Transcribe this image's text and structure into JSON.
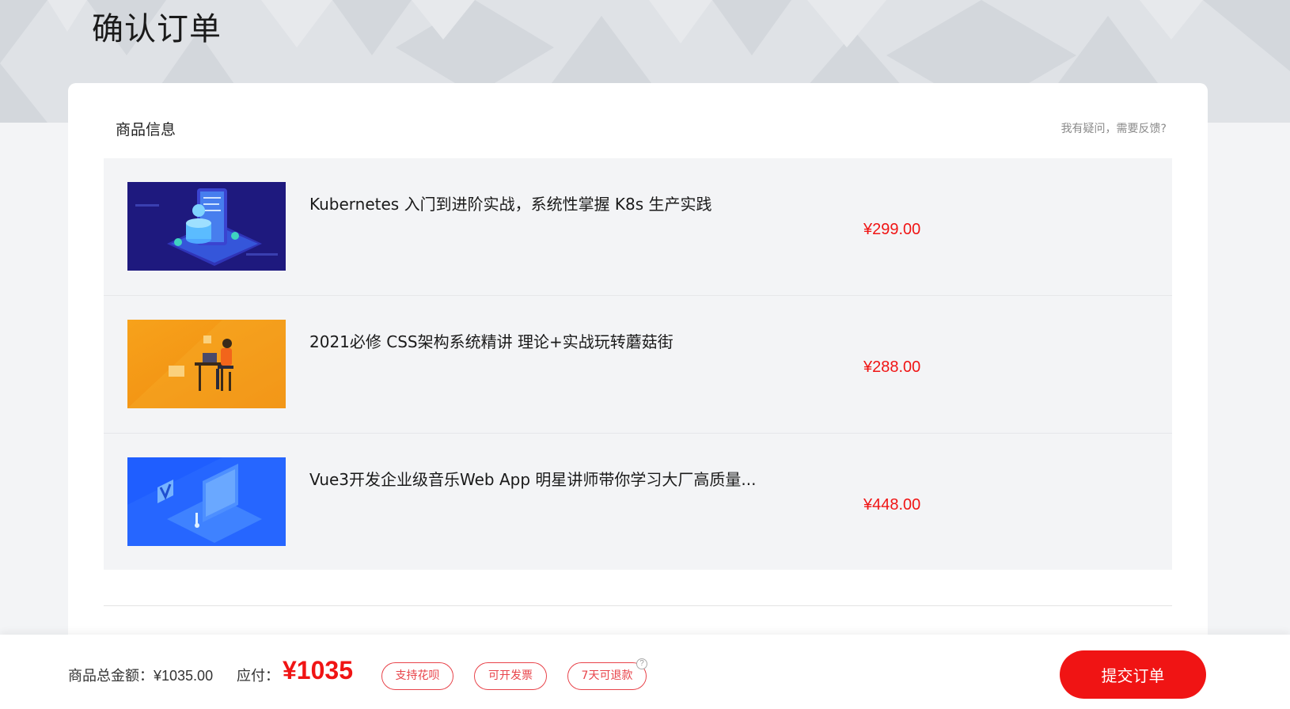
{
  "page": {
    "title": "确认订单"
  },
  "order": {
    "section_title": "商品信息",
    "feedback_link": "我有疑问，需要反馈?",
    "items": [
      {
        "name": "Kubernetes 入门到进阶实战，系统性掌握 K8s 生产实践",
        "price": "¥299.00",
        "thumb": "kubernetes-course-thumbnail"
      },
      {
        "name": "2021必修 CSS架构系统精讲 理论+实战玩转蘑菇街",
        "price": "¥288.00",
        "thumb": "css-course-thumbnail"
      },
      {
        "name": "Vue3开发企业级音乐Web App 明星讲师带你学习大厂高质量...",
        "price": "¥448.00",
        "thumb": "vue3-course-thumbnail"
      }
    ]
  },
  "footer": {
    "total_label": "商品总金额：",
    "total_value": "¥1035.00",
    "pay_label": "应付：",
    "pay_amount": "¥1035",
    "tags": [
      "支持花呗",
      "可开发票",
      "7天可退款"
    ],
    "help_icon": "?",
    "submit_label": "提交订单"
  },
  "colors": {
    "accent": "#f01414",
    "tag_border": "#e8434a",
    "background": "#f3f4f6"
  }
}
